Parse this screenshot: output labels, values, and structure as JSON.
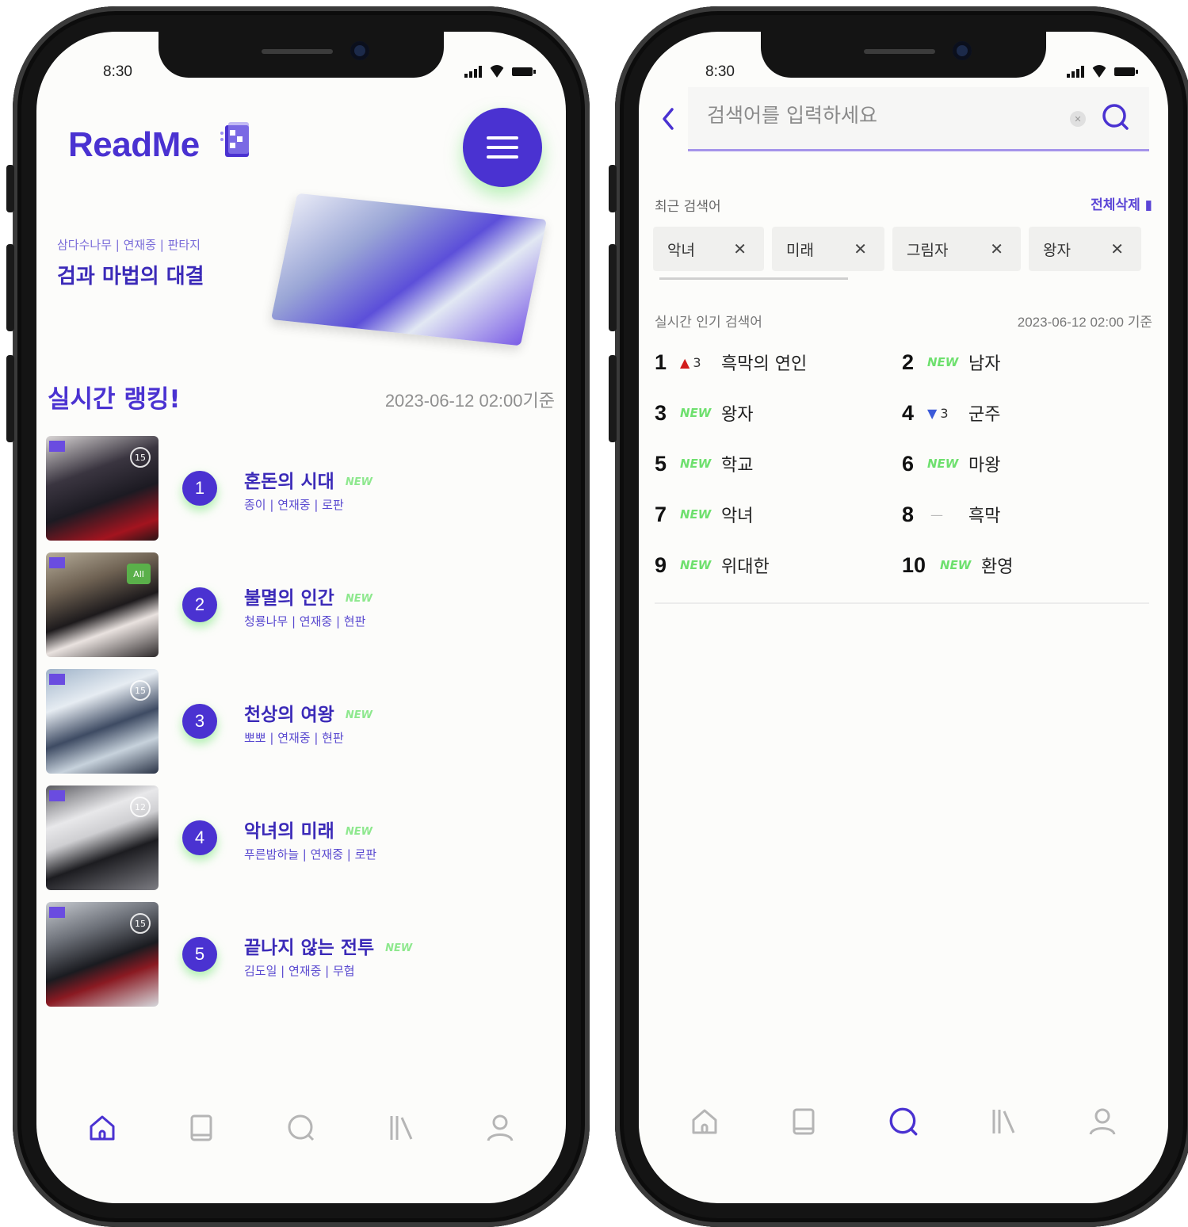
{
  "colors": {
    "brand": "#4a32d1",
    "new_green": "#8ee88e",
    "rank_up": "#d21c1c",
    "rank_down": "#3c5bd9"
  },
  "home": {
    "time": "8:30",
    "logo_text": "ReadMe",
    "featured": {
      "meta": "삼다수나무 | 연재중 | 판타지",
      "title": "검과 마법의 대결"
    },
    "ranking": {
      "title": "실시간 랭킹!",
      "date": "2023-06-12 02:00기준",
      "new_label": "NEW",
      "items": [
        {
          "rank": "1",
          "title": "혼돈의 시대",
          "meta": "종이 | 연재중 | 로판",
          "age": "15"
        },
        {
          "rank": "2",
          "title": "불멸의 인간",
          "meta": "청룡나무 | 연재중 | 현판",
          "age": "All"
        },
        {
          "rank": "3",
          "title": "천상의 여왕",
          "meta": "뽀뽀 | 연재중 | 현판",
          "age": "15"
        },
        {
          "rank": "4",
          "title": "악녀의 미래",
          "meta": "푸른밤하늘 | 연재중 | 로판",
          "age": "12"
        },
        {
          "rank": "5",
          "title": "끝나지 않는 전투",
          "meta": "김도일 | 연재중 | 무협",
          "age": "15"
        }
      ]
    },
    "tabs": [
      {
        "icon": "home-icon",
        "active": true
      },
      {
        "icon": "book-icon",
        "active": false
      },
      {
        "icon": "search-icon",
        "active": false
      },
      {
        "icon": "library-icon",
        "active": false
      },
      {
        "icon": "profile-icon",
        "active": false
      }
    ]
  },
  "search": {
    "time": "8:30",
    "placeholder": "검색어를 입력하세요",
    "recent_label": "최근 검색어",
    "delete_all": "전체삭제",
    "recent": [
      "악녀",
      "미래",
      "그림자",
      "왕자"
    ],
    "popular_label": "실시간 인기 검색어",
    "popular_date": "2023-06-12 02:00 기준",
    "new_label": "NEW",
    "popular": [
      {
        "rank": "1",
        "change": "up",
        "amount": "3",
        "keyword": "흑막의 연인"
      },
      {
        "rank": "2",
        "change": "new",
        "amount": "",
        "keyword": "남자"
      },
      {
        "rank": "3",
        "change": "new",
        "amount": "",
        "keyword": "왕자"
      },
      {
        "rank": "4",
        "change": "down",
        "amount": "3",
        "keyword": "군주"
      },
      {
        "rank": "5",
        "change": "new",
        "amount": "",
        "keyword": "학교"
      },
      {
        "rank": "6",
        "change": "new",
        "amount": "",
        "keyword": "마왕"
      },
      {
        "rank": "7",
        "change": "new",
        "amount": "",
        "keyword": "악녀"
      },
      {
        "rank": "8",
        "change": "same",
        "amount": "",
        "keyword": "흑막"
      },
      {
        "rank": "9",
        "change": "new",
        "amount": "",
        "keyword": "위대한"
      },
      {
        "rank": "10",
        "change": "new",
        "amount": "",
        "keyword": "환영"
      }
    ]
  }
}
